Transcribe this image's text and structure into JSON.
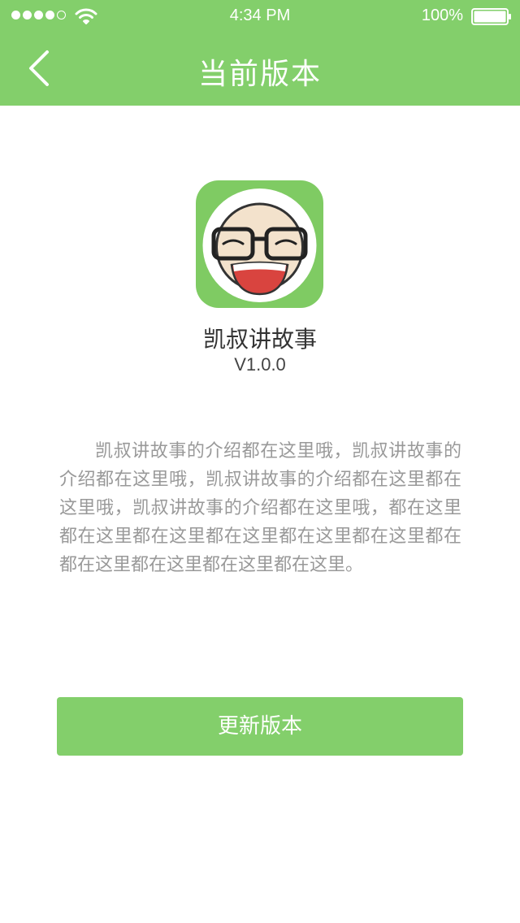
{
  "status_bar": {
    "time": "4:34 PM",
    "battery_percent": "100%",
    "signal_dots_filled": 4,
    "signal_dots_total": 5
  },
  "nav": {
    "title": "当前版本",
    "back_icon": "chevron-left-icon"
  },
  "app": {
    "icon": "app-logo-icon",
    "name": "凯叔讲故事",
    "version": "V1.0.0"
  },
  "description": "凯叔讲故事的介绍都在这里哦，凯叔讲故事的介绍都在这里哦，凯叔讲故事的介绍都在这里都在这里哦，凯叔讲故事的介绍都在这里哦，都在这里都在这里都在这里都在这里都在这里都在这里都在都在这里都在这里都在这里都在这里。",
  "actions": {
    "update_label": "更新版本"
  },
  "colors": {
    "brand_green": "#83cf6b",
    "text_gray": "#999999"
  }
}
